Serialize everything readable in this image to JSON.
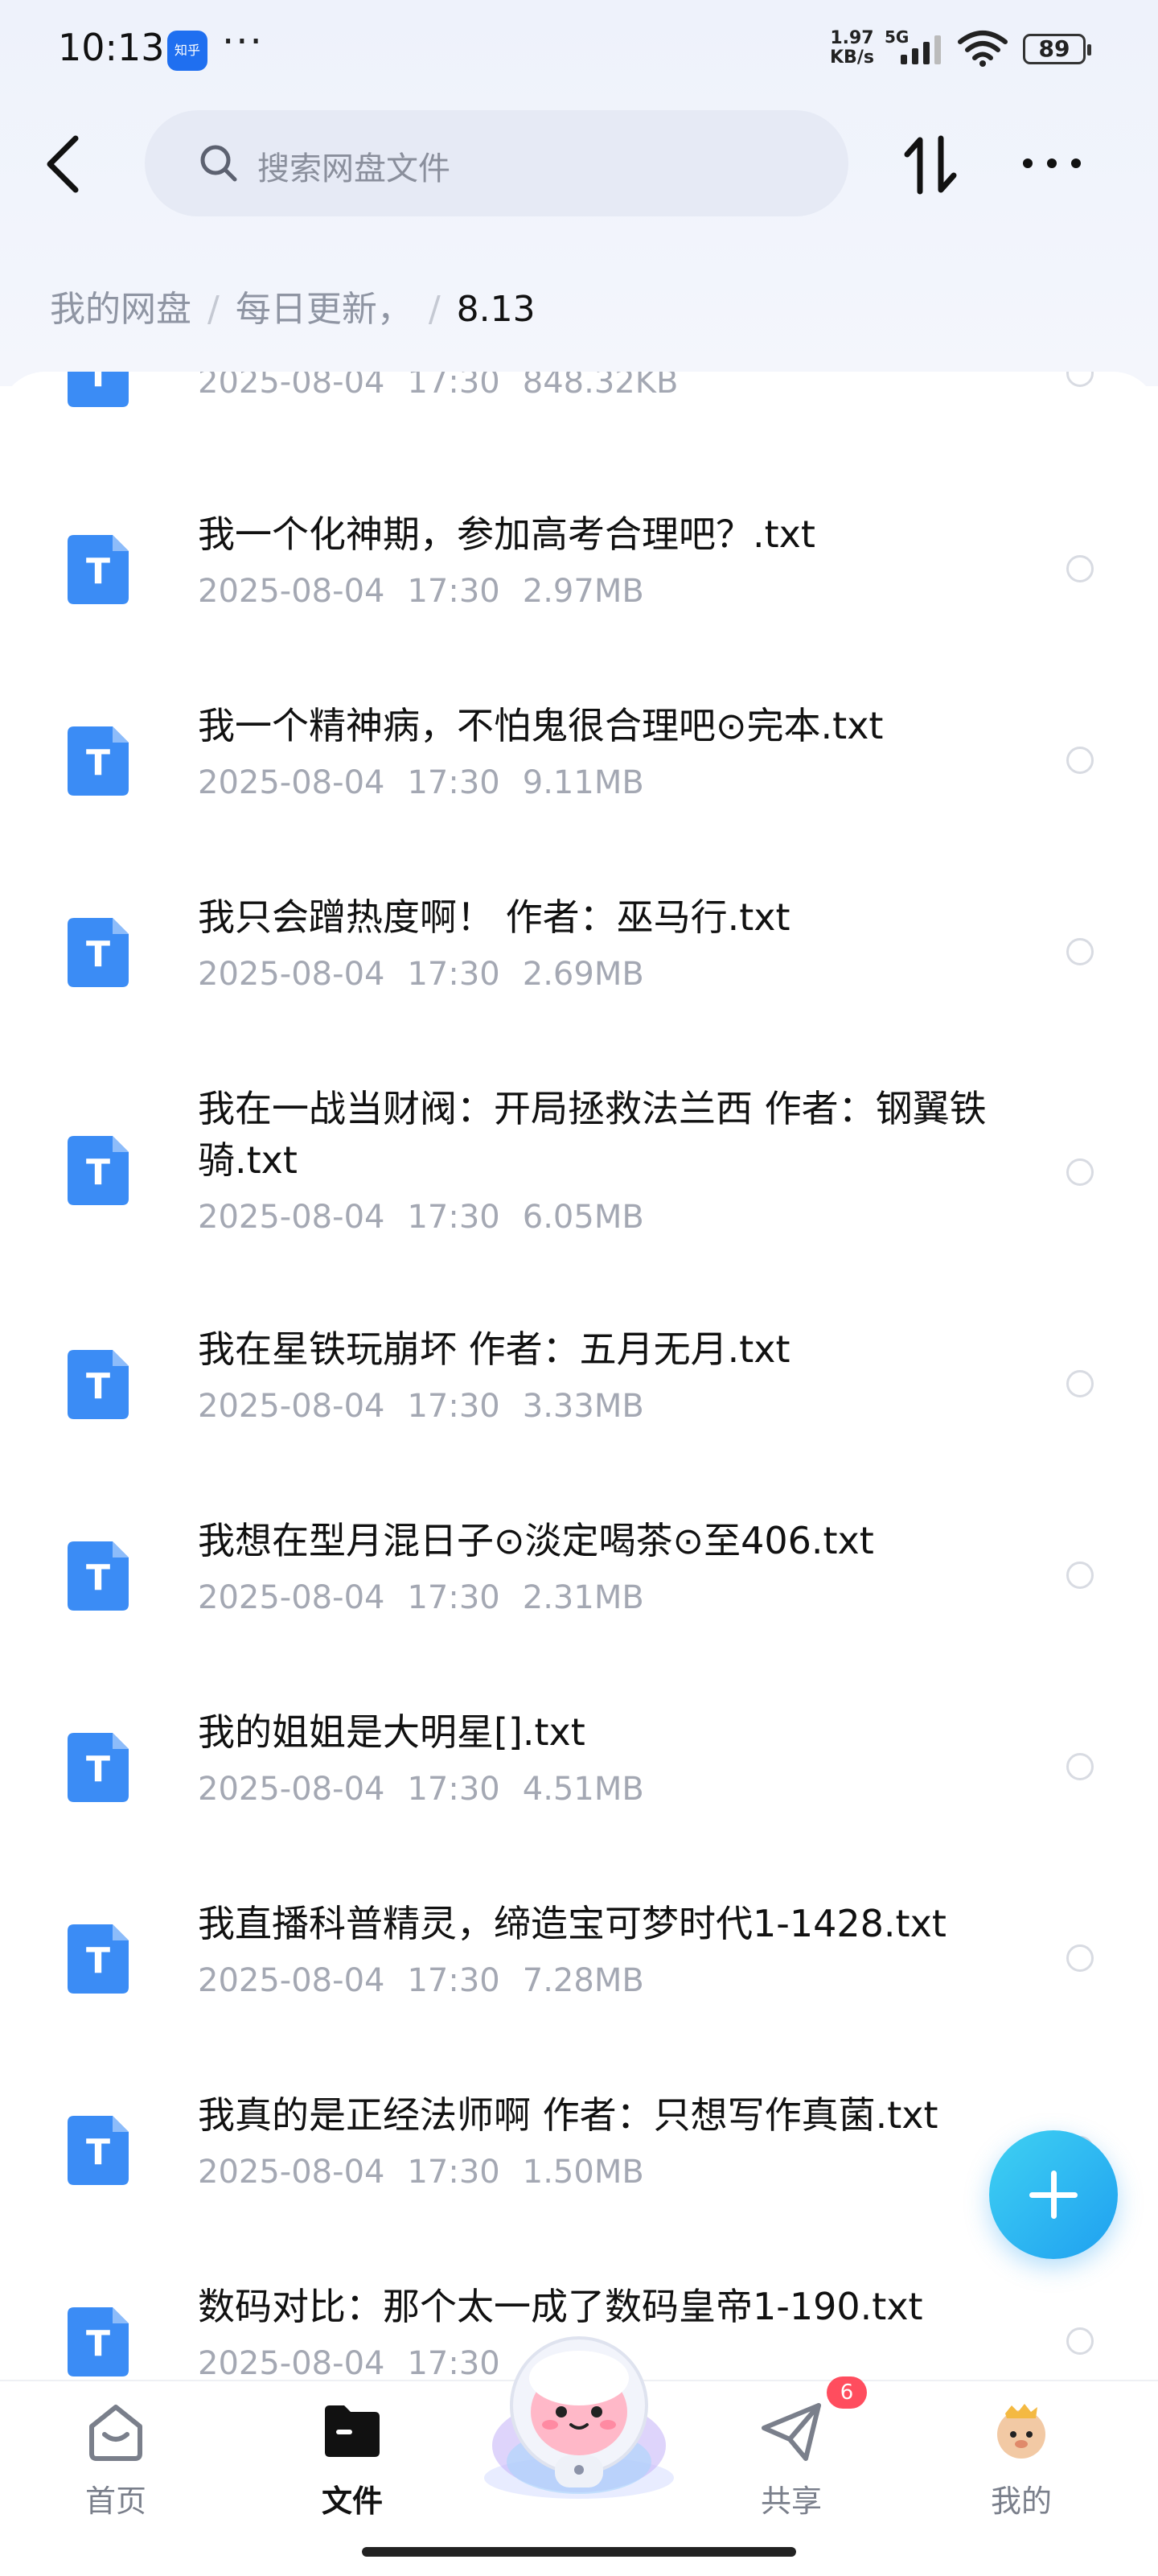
{
  "status_bar": {
    "time": "10:13",
    "app_icon_label": "知乎",
    "more": "···",
    "speed_value": "1.97",
    "speed_unit": "KB/s",
    "network": "5G",
    "battery": "89"
  },
  "header": {
    "search_placeholder": "搜索网盘文件"
  },
  "breadcrumb": {
    "items": [
      "我的网盘",
      "每日更新，",
      "8.13"
    ]
  },
  "files": [
    {
      "name": "",
      "date": "2025-08-04",
      "time": "17:30",
      "size": "848.32KB"
    },
    {
      "name": "我一个化神期，参加高考合理吧？.txt",
      "date": "2025-08-04",
      "time": "17:30",
      "size": "2.97MB"
    },
    {
      "name": "我一个精神病，不怕鬼很合理吧⊙完本.txt",
      "date": "2025-08-04",
      "time": "17:30",
      "size": "9.11MB"
    },
    {
      "name": "我只会蹭热度啊！ 作者：巫马行.txt",
      "date": "2025-08-04",
      "time": "17:30",
      "size": "2.69MB"
    },
    {
      "name": "我在一战当财阀：开局拯救法兰西 作者：钢翼铁骑.txt",
      "date": "2025-08-04",
      "time": "17:30",
      "size": "6.05MB"
    },
    {
      "name": "我在星铁玩崩坏 作者：五月无月.txt",
      "date": "2025-08-04",
      "time": "17:30",
      "size": "3.33MB"
    },
    {
      "name": "我想在型月混日子⊙淡定喝茶⊙至406.txt",
      "date": "2025-08-04",
      "time": "17:30",
      "size": "2.31MB"
    },
    {
      "name": "我的姐姐是大明星[].txt",
      "date": "2025-08-04",
      "time": "17:30",
      "size": "4.51MB"
    },
    {
      "name": "我直播科普精灵，缔造宝可梦时代1-1428.txt",
      "date": "2025-08-04",
      "time": "17:30",
      "size": "7.28MB"
    },
    {
      "name": "我真的是正经法师啊 作者：只想写作真菌.txt",
      "date": "2025-08-04",
      "time": "17:30",
      "size": "1.50MB"
    },
    {
      "name": "数码对比：那个太一成了数码皇帝1-190.txt",
      "date": "2025-08-04",
      "time": "17:30",
      "size": ""
    }
  ],
  "nav": {
    "home": "首页",
    "files": "文件",
    "share": "共享",
    "share_badge": "6",
    "mine": "我的"
  },
  "colors": {
    "accent": "#1fa0f0",
    "file_icon": "#3b8cf5",
    "badge": "#ff4d5e"
  }
}
